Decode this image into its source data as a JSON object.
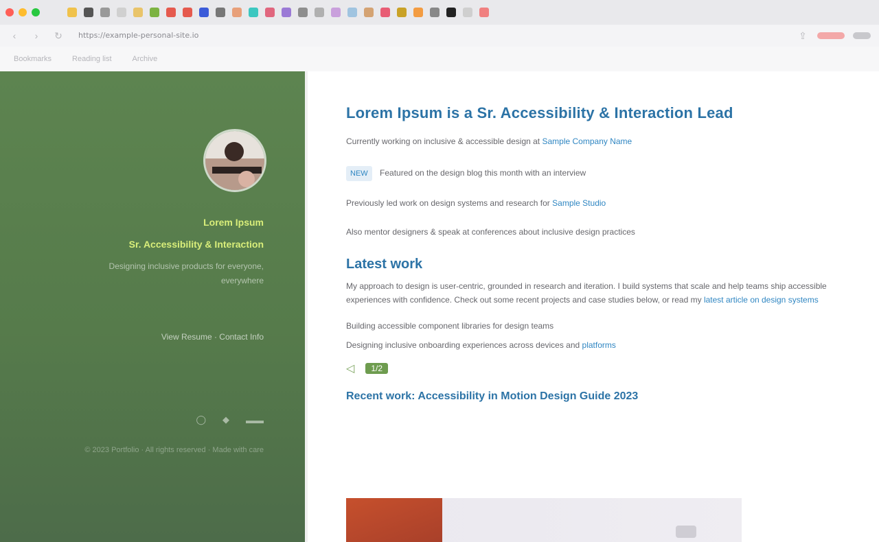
{
  "browser": {
    "address": "https://example-personal-site.io",
    "traffic_colors": [
      "#ff5f57",
      "#febc2e",
      "#28c840"
    ],
    "tab_favicon_colors": [
      "#f0c24b",
      "#555555",
      "#999999",
      "#d0d0d0",
      "#e9c46a",
      "#7cb342",
      "#e55a4e",
      "#e55a4e",
      "#3b5bd9",
      "#777777",
      "#e8a07a",
      "#3cc7c0",
      "#e0667e",
      "#9b7ad6",
      "#8e8e8e",
      "#b0b0b0",
      "#c9a0dc",
      "#a0c4e0",
      "#d4a373",
      "#e85d75",
      "#c9a227",
      "#f39c42",
      "#888888",
      "#222222",
      "#cfcfcf",
      "#f08080"
    ],
    "bookmarks": [
      "Bookmarks",
      "Reading list",
      "Archive"
    ]
  },
  "sidebar": {
    "name": "Lorem Ipsum",
    "role": "Sr. Accessibility & Interaction",
    "description": "Designing inclusive products for everyone, everywhere",
    "link": "View Resume · Contact Info",
    "social": [
      "github-icon",
      "twitter-icon",
      "rss-icon"
    ],
    "footer": "© 2023 Portfolio · All rights reserved · Made with care"
  },
  "main": {
    "title": "Lorem Ipsum is a Sr. Accessibility & Interaction Lead",
    "intro": "Currently working on inclusive & accessible design at",
    "intro_link": "Sample Company Name",
    "badge": "NEW",
    "badge_text": "Featured on the design blog this month with an interview",
    "line2": "Previously led work on design systems and research for",
    "line2_link": "Sample Studio",
    "line3": "Also mentor designers & speak at conferences about inclusive design practices",
    "section_title": "Latest work",
    "section_body": "My approach to design is user-centric, grounded in research and iteration. I build systems that scale and help teams ship accessible experiences with confidence. Check out some recent projects and case studies below, or read my",
    "section_link": "latest article on design systems",
    "list1": "Building accessible component libraries for design teams",
    "list2": "Designing inclusive onboarding experiences across devices and",
    "list2_link": "platforms",
    "count": "1/2",
    "recent_title": "Recent work: Accessibility in Motion Design Guide 2023"
  }
}
